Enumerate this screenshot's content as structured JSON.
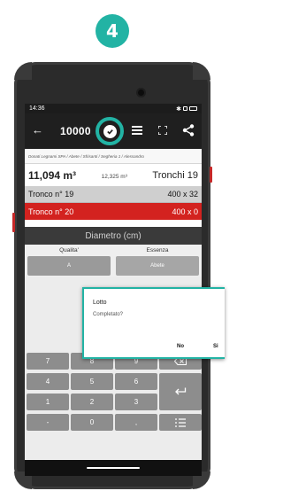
{
  "step_badge": "4",
  "status": {
    "time": "14:36"
  },
  "appbar": {
    "count": "10000"
  },
  "breadcrumb": "Donati Legnami SPA / Abete / Sfrisanti / Segheria 1 / Alessandro",
  "summary": {
    "volume_total": "11,094 m³",
    "volume_partial": "12,325 m³",
    "tronchi": "Tronchi 19"
  },
  "rows": [
    {
      "label": "Tronco n° 19",
      "value": "400 x 32"
    },
    {
      "label": "Tronco n° 20",
      "value": "400 x 0"
    }
  ],
  "diametro_label": "Diametro (cm)",
  "selectors": {
    "left_header": "Qualita'",
    "right_header": "Essenza",
    "left_value": "A",
    "right_value": "Abete"
  },
  "keypad": {
    "k7": "7",
    "k8": "8",
    "k9": "9",
    "k4": "4",
    "k5": "5",
    "k6": "6",
    "k1": "1",
    "k2": "2",
    "k3": "3",
    "kdash": "-",
    "k0": "0",
    "kcomma": ","
  },
  "dialog": {
    "title": "Lotto",
    "message": "Completato?",
    "no": "No",
    "yes": "Si"
  },
  "colors": {
    "accent": "#22b3a4",
    "selected_row": "#d3221f",
    "appbar": "#1f1f1f"
  },
  "icons": [
    "back-icon",
    "check-icon",
    "list-icon",
    "fullscreen-icon",
    "share-icon",
    "backspace-icon",
    "enter-icon",
    "list-menu-icon"
  ]
}
